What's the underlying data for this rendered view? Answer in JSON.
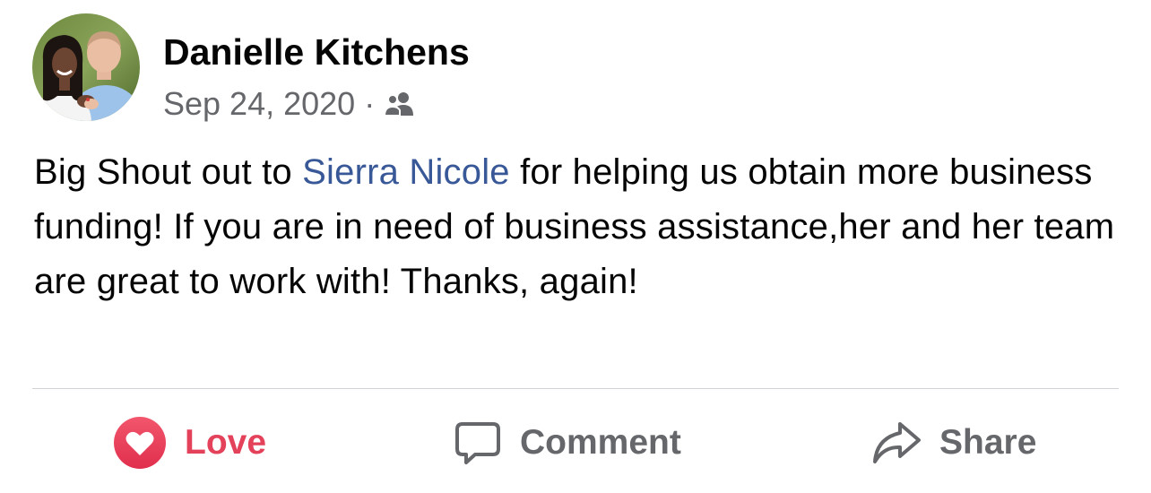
{
  "post": {
    "author": "Danielle Kitchens",
    "date": "Sep 24, 2020",
    "separator": "·",
    "audience_icon": "friends-icon",
    "text_before_mention": "Big Shout out to ",
    "mention": "Sierra Nicole",
    "text_after_mention": " for helping us obtain more business funding! If you are in need of business assistance,her and her team are great to work with! Thanks, again!"
  },
  "actions": {
    "love_label": "Love",
    "comment_label": "Comment",
    "share_label": "Share"
  },
  "colors": {
    "text": "#050505",
    "secondary": "#65676b",
    "mention": "#385898",
    "love": "#e4415a",
    "divider": "#d0d2d6"
  },
  "icons": {
    "love": "heart-icon",
    "comment": "speech-bubble-icon",
    "share": "share-arrow-icon"
  }
}
